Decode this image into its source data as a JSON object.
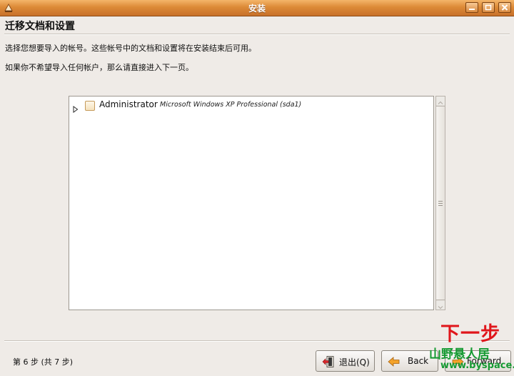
{
  "window": {
    "title": "安装"
  },
  "header": {
    "title": "迁移文档和设置",
    "line1": "选择您想要导入的帐号。这些帐号中的文档和设置将在安装结束后可用。",
    "line2": "如果你不希望导入任何帐户，那么请直接进入下一页。"
  },
  "accounts": [
    {
      "name": "Administrator",
      "system": "Microsoft Windows XP Professional (sda1)",
      "checked": false,
      "expanded": false
    }
  ],
  "footer": {
    "step": "第 6 步 (共 7 步)",
    "quit_label": "退出(Q)",
    "back_label": "Back",
    "forward_label": "Forward"
  },
  "watermark": {
    "caption": "下一步",
    "site": "山野悬人居",
    "url": "www.byspace.net"
  },
  "colors": {
    "titlebar": "#dc8a37",
    "window_bg": "#efebe7",
    "list_bg": "#ffffff",
    "watermark_red": "#e0161b",
    "watermark_green": "#159a32"
  },
  "icons": [
    "app-icon",
    "minimize-icon",
    "maximize-icon",
    "close-icon",
    "expander-icon",
    "quit-icon",
    "back-arrow-icon",
    "forward-arrow-icon"
  ]
}
